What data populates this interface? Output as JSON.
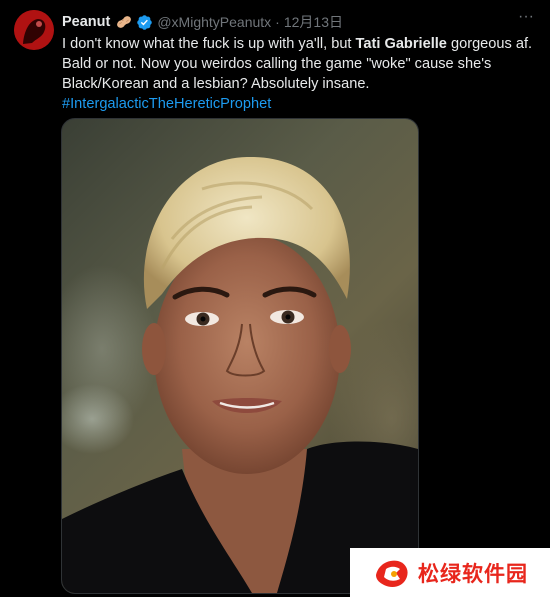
{
  "tweet": {
    "author": {
      "display_name": "Peanut",
      "handle": "@xMightyPeanutx",
      "verified": true,
      "emoji": "peanut-emoji"
    },
    "separator": "·",
    "timestamp": "12月13日",
    "more_label": "···",
    "text_part1": "I don't know what the fuck is up with ya'll, but ",
    "text_bold": "Tati Gabrielle",
    "text_part2": " gorgeous af. Bald or not. Now you weirdos calling the game \"woke\" cause she's Black/Korean and a lesbian? Absolutely insane.",
    "hashtag": "#IntergalacticTheHereticProphet",
    "media": {
      "type": "photo",
      "subject": "portrait"
    }
  },
  "watermark": {
    "text": "松绿软件园",
    "color": "#e8261c"
  },
  "colors": {
    "background": "#000000",
    "text": "#e7e9ea",
    "muted": "#71767b",
    "link": "#1d9bf0",
    "verified": "#1d9bf0"
  }
}
